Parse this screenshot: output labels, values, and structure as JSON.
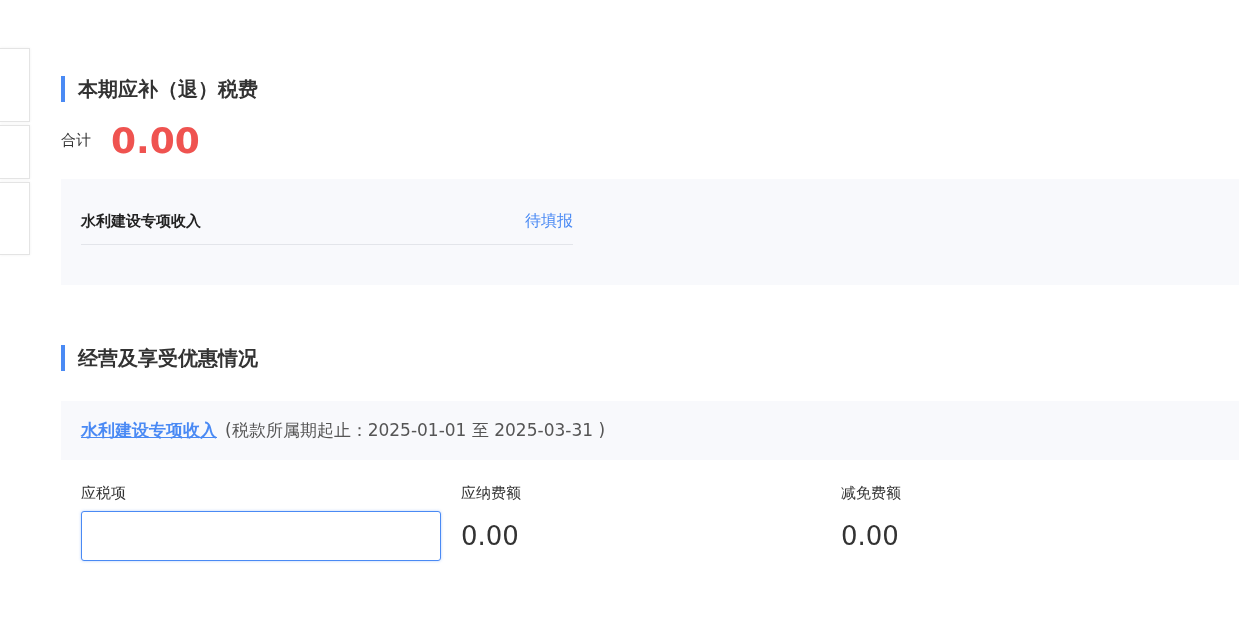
{
  "side_tabs": [
    {
      "selected": false
    },
    {
      "selected": false
    },
    {
      "selected": false
    }
  ],
  "tax_section": {
    "title": "本期应补（退）税费",
    "total_label": "合计",
    "total_value": "0.00",
    "items": [
      {
        "name": "水利建设专项收入",
        "status": "待填报"
      }
    ]
  },
  "business_section": {
    "title": "经营及享受优惠情况",
    "items": [
      {
        "link": "水利建设专项收入",
        "period": "(税款所属期起止：2025-01-01 至 2025-03-31 )"
      }
    ],
    "fields": [
      {
        "kind": "input",
        "label": "应税项"
      },
      {
        "kind": "value",
        "label": "应纳费额",
        "value": "0.00"
      },
      {
        "kind": "value",
        "label": "减免费额",
        "value": "0.00"
      }
    ]
  }
}
